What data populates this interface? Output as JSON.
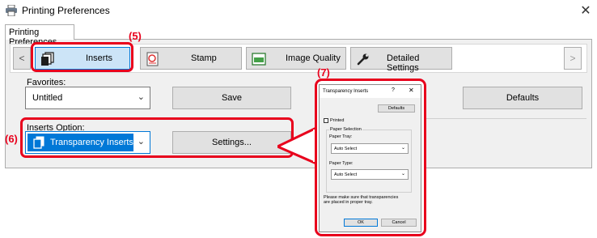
{
  "window": {
    "title": "Printing Preferences",
    "close_glyph": "✕",
    "app_icon": "printer-icon"
  },
  "main_tab": {
    "label": "Printing Preferences"
  },
  "toolbar": {
    "prev_glyph": "<",
    "next_glyph": ">",
    "buttons": [
      {
        "label": "Inserts",
        "icon": "inserts-icon",
        "active": true
      },
      {
        "label": "Stamp",
        "icon": "stamp-icon",
        "active": false
      },
      {
        "label": "Image Quality",
        "icon": "image-quality-icon",
        "active": false
      },
      {
        "label": "Detailed Settings",
        "icon": "wrench-icon",
        "active": false
      }
    ]
  },
  "favorites": {
    "label": "Favorites:",
    "value": "Untitled",
    "save_label": "Save",
    "defaults_label": "Defaults"
  },
  "inserts_option": {
    "label": "Inserts Option:",
    "value": "Transparency Inserts",
    "settings_label": "Settings..."
  },
  "callouts": {
    "step5": "(5)",
    "step6": "(6)",
    "step7": "(7)"
  },
  "dialog": {
    "title": "Transparency Inserts",
    "help_glyph": "?",
    "close_glyph": "✕",
    "defaults_label": "Defaults",
    "printed_label": "Printed",
    "printed_checked": false,
    "group_label": "Paper Selection",
    "paper_tray_label": "Paper Tray:",
    "paper_tray_value": "Auto Select",
    "paper_type_label": "Paper Type:",
    "paper_type_value": "Auto Select",
    "note_line1": "Please make sure that transparencies",
    "note_line2": "are placed in proper tray.",
    "ok_label": "OK",
    "cancel_label": "Cancel"
  },
  "colors": {
    "callout": "#e8001c",
    "selected_blue": "#0078d7",
    "active_fill": "#cce4f7"
  }
}
